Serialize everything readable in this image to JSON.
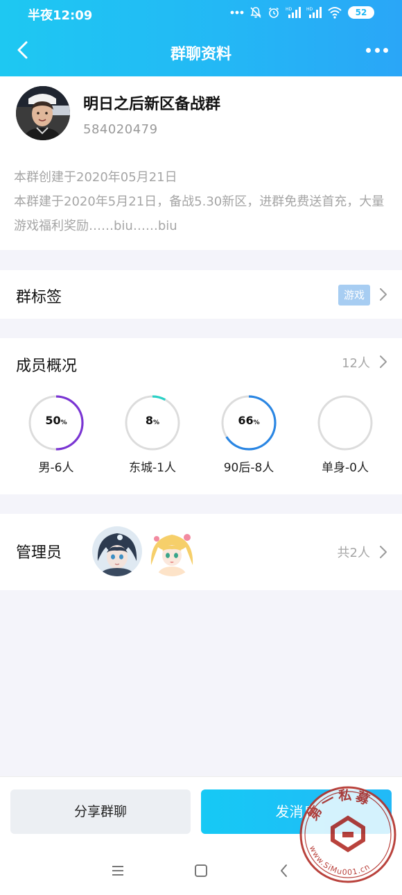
{
  "status_bar": {
    "time": "半夜12:09",
    "battery": "52",
    "hd_label": "HD"
  },
  "nav": {
    "title": "群聊资料"
  },
  "group": {
    "name": "明日之后新区备战群",
    "id": "584020479",
    "created": "本群创建于2020年05月21日",
    "description": "本群建于2020年5月21日，备战5.30新区，进群免费送首充，大量游戏福利奖励……biu……biu"
  },
  "tags": {
    "title": "群标签",
    "tag": "游戏"
  },
  "members": {
    "title": "成员概况",
    "count": "12人",
    "stats": [
      {
        "label": "男-6人",
        "value": "50",
        "percent": 50,
        "color": "#7a35d3"
      },
      {
        "label": "东城-1人",
        "value": "8",
        "percent": 8,
        "color": "#2cd1c6"
      },
      {
        "label": "90后-8人",
        "value": "66",
        "percent": 66,
        "color": "#2a86e3"
      },
      {
        "label": "单身-0人",
        "value": "",
        "percent": 0,
        "color": "#2a86e3"
      }
    ],
    "percent_sign": "%"
  },
  "admins": {
    "title": "管理员",
    "count": "共2人"
  },
  "actions": {
    "share": "分享群聊",
    "send": "发消息"
  },
  "watermark": {
    "text": "第一私募",
    "url": "www.SiMu001.cn"
  },
  "colors": {
    "header_start": "#1ec8f2",
    "header_end": "#2aa6f7",
    "tag_badge": "#a7cdf2"
  }
}
